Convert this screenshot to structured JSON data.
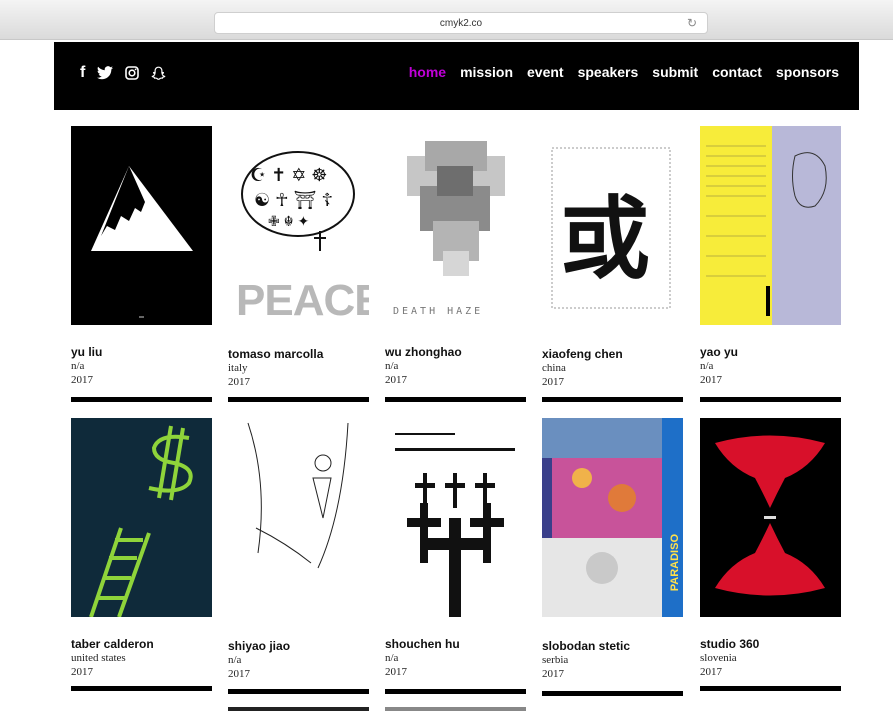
{
  "browser": {
    "url": "cmyk2.co"
  },
  "social": {
    "icons": [
      "facebook-icon",
      "twitter-icon",
      "instagram-icon",
      "snapchat-icon"
    ],
    "facebook_glyph": "f"
  },
  "nav": {
    "items": [
      "home",
      "mission",
      "event",
      "speakers",
      "submit",
      "contact",
      "sponsors"
    ],
    "active": "home",
    "active_color": "#c000d8"
  },
  "posters": [
    {
      "name": "yu liu",
      "country": "n/a",
      "year": "2017"
    },
    {
      "name": "tomaso marcolla",
      "country": "italy",
      "year": "2017",
      "poster_text": "PEACE"
    },
    {
      "name": "wu zhonghao",
      "country": "n/a",
      "year": "2017",
      "poster_text": "DEATH HAZE"
    },
    {
      "name": "xiaofeng chen",
      "country": "china",
      "year": "2017",
      "poster_text": "或"
    },
    {
      "name": "yao yu",
      "country": "n/a",
      "year": "2017"
    },
    {
      "name": "taber calderon",
      "country": "united states",
      "year": "2017"
    },
    {
      "name": "shiyao jiao",
      "country": "n/a",
      "year": "2017"
    },
    {
      "name": "shouchen hu",
      "country": "n/a",
      "year": "2017"
    },
    {
      "name": "slobodan stetic",
      "country": "serbia",
      "year": "2017",
      "poster_text": "PARADISO"
    },
    {
      "name": "studio 360",
      "country": "slovenia",
      "year": "2017"
    }
  ]
}
